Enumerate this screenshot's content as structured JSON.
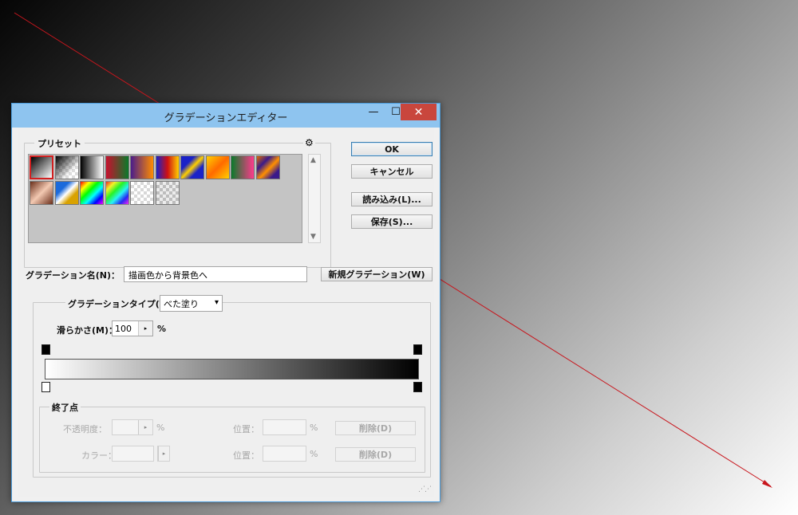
{
  "window": {
    "title": "グラデーションエディター",
    "min_glyph": "—",
    "max_glyph": "☐",
    "close_glyph": "✕"
  },
  "preset": {
    "label": "プリセット",
    "gear_glyph": "⚙",
    "scroll_up": "▲",
    "scroll_down": "▼"
  },
  "buttons": {
    "ok": "OK",
    "cancel": "キャンセル",
    "load": "読み込み(L)...",
    "save": "保存(S)...",
    "new_gradient": "新規グラデーション(W)"
  },
  "name_field": {
    "label": "グラデーション名(N)：",
    "value": "描画色から背景色へ"
  },
  "gradient_type": {
    "label": "グラデーションタイプ(T)：",
    "value": "べた塗り",
    "caret": "▾"
  },
  "smoothness": {
    "label": "滑らかさ(M)：",
    "value": "100",
    "arrow": "▸",
    "unit": "%"
  },
  "stops": {
    "label": "終了点",
    "opacity_label": "不透明度：",
    "color_label": "カラー：",
    "position_label": "位置：",
    "percent": "%",
    "delete_label": "削除(D)",
    "arrow": "▸"
  },
  "colors": {
    "accent_close": "#c9463d",
    "titlebar": "#8ec4ef",
    "selection": "#d21f1f"
  }
}
